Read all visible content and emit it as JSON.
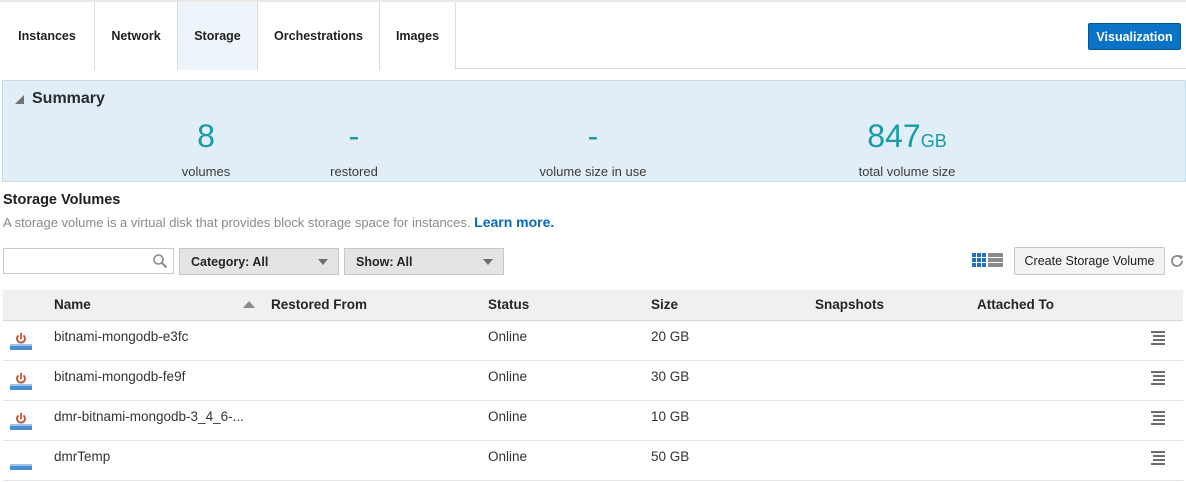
{
  "tabs": [
    {
      "label": "Instances",
      "active": false
    },
    {
      "label": "Network",
      "active": false
    },
    {
      "label": "Storage",
      "active": true
    },
    {
      "label": "Orchestrations",
      "active": false
    },
    {
      "label": "Images",
      "active": false
    }
  ],
  "header": {
    "visualization_label": "Visualization"
  },
  "summary": {
    "title": "Summary",
    "metrics": [
      {
        "value": "8",
        "unit": "",
        "label": "volumes"
      },
      {
        "value": "-",
        "unit": "",
        "label": "restored"
      },
      {
        "value": "-",
        "unit": "",
        "label": "volume size in use"
      },
      {
        "value": "847",
        "unit": "GB",
        "label": "total volume size"
      }
    ]
  },
  "storage_volumes": {
    "title": "Storage Volumes",
    "description": "A storage volume is a virtual disk that provides block storage space for instances.",
    "learn_more": "Learn more."
  },
  "filters": {
    "search_value": "",
    "search_placeholder": "",
    "category_label": "Category: All",
    "show_label": "Show: All",
    "create_label": "Create Storage Volume"
  },
  "table": {
    "columns": {
      "name": "Name",
      "restored_from": "Restored From",
      "status": "Status",
      "size": "Size",
      "snapshots": "Snapshots",
      "attached_to": "Attached To"
    },
    "rows": [
      {
        "icon": "bootable-volume-icon",
        "name": "bitnami-mongodb-e3fc",
        "restored_from": "",
        "status": "Online",
        "size": "20 GB",
        "snapshots": "",
        "attached_to": ""
      },
      {
        "icon": "bootable-volume-icon",
        "name": "bitnami-mongodb-fe9f",
        "restored_from": "",
        "status": "Online",
        "size": "30 GB",
        "snapshots": "",
        "attached_to": ""
      },
      {
        "icon": "bootable-volume-icon",
        "name": "dmr-bitnami-mongodb-3_4_6-...",
        "restored_from": "",
        "status": "Online",
        "size": "10 GB",
        "snapshots": "",
        "attached_to": ""
      },
      {
        "icon": "data-volume-icon",
        "name": "dmrTemp",
        "restored_from": "",
        "status": "Online",
        "size": "50 GB",
        "snapshots": "",
        "attached_to": ""
      }
    ]
  },
  "colors": {
    "accent": "#0a73c6",
    "metric": "#1a9ba8",
    "summary_bg": "#e1eef7",
    "power_icon": "#c0532a",
    "volume_icon": "#4a8fd0"
  }
}
